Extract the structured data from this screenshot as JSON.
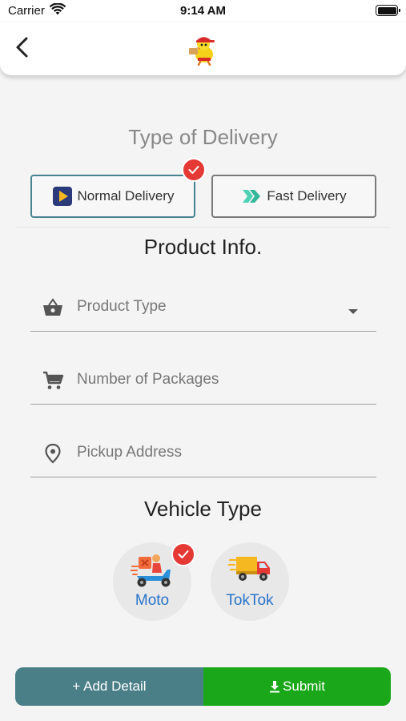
{
  "status_bar": {
    "carrier": "Carrier",
    "time": "9:14 AM"
  },
  "app_bar": {
    "back_icon": "chevron-left-icon",
    "logo": "mascot-logo"
  },
  "delivery": {
    "title": "Type of Delivery",
    "options": [
      {
        "label": "Normal Delivery",
        "icon": "play-icon",
        "selected": true
      },
      {
        "label": "Fast Delivery",
        "icon": "double-chevron-right-icon",
        "selected": false
      }
    ]
  },
  "product": {
    "title": "Product Info.",
    "fields": [
      {
        "placeholder": "Product Type",
        "icon": "basket-icon",
        "dropdown": true
      },
      {
        "placeholder": "Number of Packages",
        "icon": "cart-icon",
        "dropdown": false
      },
      {
        "placeholder": "Pickup Address",
        "icon": "location-pin-icon",
        "dropdown": false
      }
    ]
  },
  "vehicle": {
    "title": "Vehicle Type",
    "options": [
      {
        "label": "Moto",
        "icon": "scooter-icon",
        "selected": true
      },
      {
        "label": "TokTok",
        "icon": "truck-icon",
        "selected": false
      }
    ]
  },
  "actions": {
    "add_detail": "+ Add Detail",
    "submit": "Submit"
  },
  "colors": {
    "accent": "#4a8390",
    "badge": "#e53935",
    "submit": "#1aa81a",
    "add": "#4b7f88",
    "vehicle_label": "#2a74c9"
  }
}
